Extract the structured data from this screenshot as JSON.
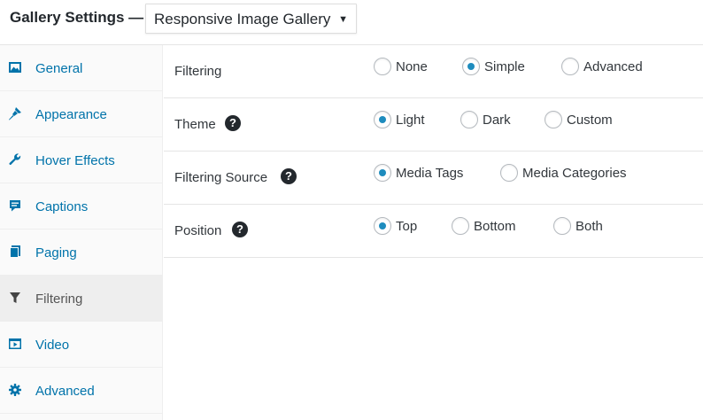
{
  "header": {
    "title": "Gallery Settings —",
    "selected_gallery": "Responsive Image Gallery",
    "dropdown_arrow": "▼"
  },
  "sidebar": {
    "items": [
      {
        "label": "General",
        "icon": "image-icon",
        "active": false
      },
      {
        "label": "Appearance",
        "icon": "brush-icon",
        "active": false
      },
      {
        "label": "Hover Effects",
        "icon": "wrench-icon",
        "active": false
      },
      {
        "label": "Captions",
        "icon": "caption-icon",
        "active": false
      },
      {
        "label": "Paging",
        "icon": "pages-icon",
        "active": false
      },
      {
        "label": "Filtering",
        "icon": "filter-icon",
        "active": true
      },
      {
        "label": "Video",
        "icon": "video-icon",
        "active": false
      },
      {
        "label": "Advanced",
        "icon": "gear-icon",
        "active": false
      }
    ]
  },
  "settings": {
    "rows": [
      {
        "label": "Filtering",
        "help": false,
        "options": [
          "None",
          "Simple",
          "Advanced"
        ],
        "selected": "Simple"
      },
      {
        "label": "Theme",
        "help": true,
        "options": [
          "Light",
          "Dark",
          "Custom"
        ],
        "selected": "Light"
      },
      {
        "label": "Filtering Source",
        "help": true,
        "options": [
          "Media Tags",
          "Media Categories"
        ],
        "selected": "Media Tags"
      },
      {
        "label": "Position",
        "help": true,
        "options": [
          "Top",
          "Bottom",
          "Both"
        ],
        "selected": "Top"
      }
    ],
    "help_symbol": "?"
  },
  "colors": {
    "link": "#0073aa",
    "radio_checked": "#1e8cbe",
    "text": "#23282d"
  }
}
